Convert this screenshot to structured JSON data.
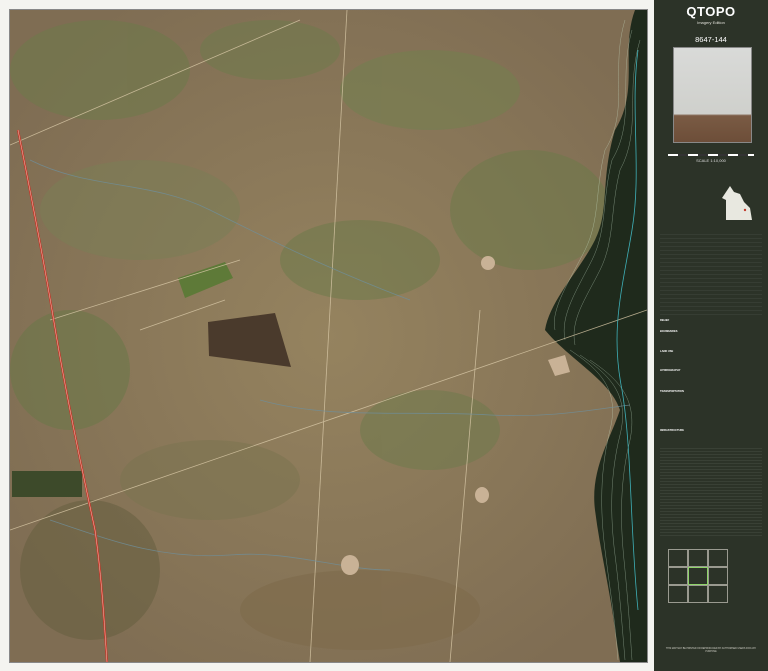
{
  "map": {
    "title": "QTOPO",
    "subtitle": "Imagery Edition",
    "sheet_number": "8647-144",
    "scale": "SCALE 1:10,000",
    "colors": {
      "panel": "#2c3328",
      "terrain": "#8c7a5e",
      "vegetation": "#5a6b3a",
      "ridge": "#1e2b1c",
      "highway": "#c23b2c",
      "contour": "#cfe8d0"
    },
    "panel_text": {
      "disclaimer_title": "THIS MAP MAY BE PRINTED OR REPRODUCED BY AUTHORISED USERS FOR ANY PURPOSE"
    },
    "legend_sections": [
      "RELIEF",
      "BOUNDARIES",
      "LAND USE",
      "HYDROGRAPHY",
      "TRANSPORTATION",
      "INFRASTRUCTURE"
    ]
  }
}
